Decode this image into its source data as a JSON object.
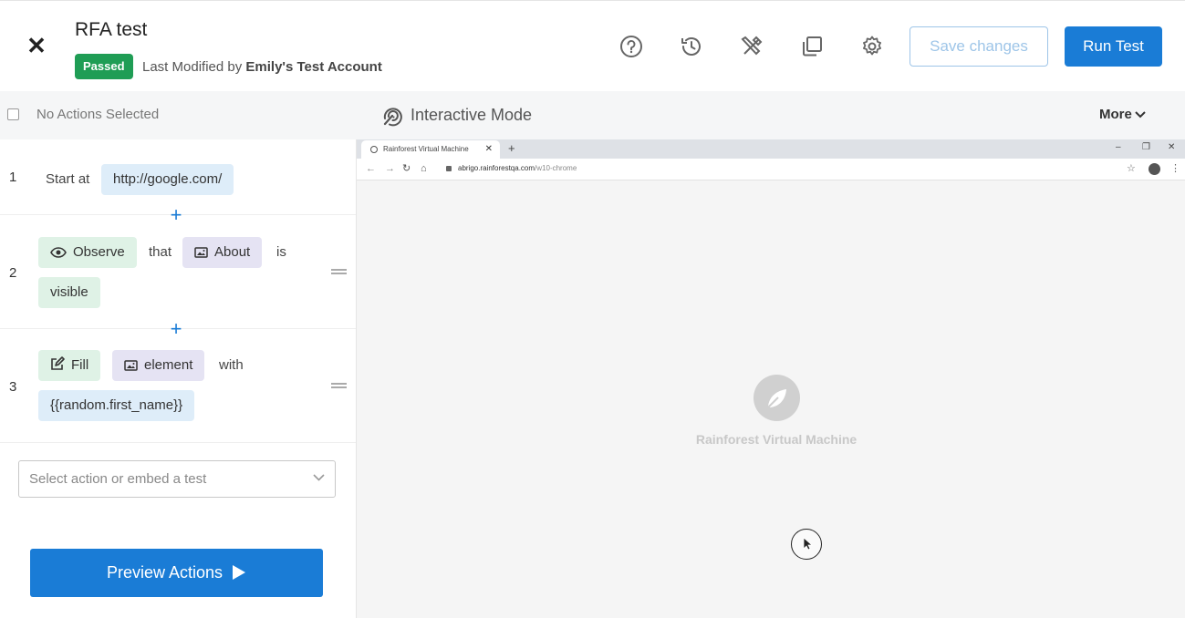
{
  "header": {
    "title": "RFA test",
    "status_badge": "Passed",
    "modified_prefix": "Last Modified by",
    "modified_by": "Emily's Test Account",
    "save_label": "Save changes",
    "run_label": "Run Test",
    "icons": [
      "close-icon",
      "help-icon",
      "history-icon",
      "tools-icon",
      "duplicate-icon",
      "settings-icon"
    ]
  },
  "subbar": {
    "selection_text": "No Actions Selected",
    "mode_label": "Interactive Mode",
    "more_label": "More"
  },
  "steps": [
    {
      "number": "1",
      "prefix": "Start at",
      "url": "http://google.com/"
    },
    {
      "number": "2",
      "action": "Observe",
      "word1": "that",
      "element": "About",
      "word2": "is",
      "value": "visible"
    },
    {
      "number": "3",
      "action": "Fill",
      "element": "element",
      "word1": "with",
      "value": "{{random.first_name}}"
    }
  ],
  "actions": {
    "select_placeholder": "Select action or embed a test",
    "preview_label": "Preview Actions"
  },
  "vm": {
    "tab_title": "Rainforest Virtual Machine",
    "url_host": "abrigo.rainforestqa.com",
    "url_path": "/w10-chrome",
    "logo_text": "Rainforest Virtual Machine"
  },
  "colors": {
    "accent": "#1a7cd6",
    "passed": "#1f9d55",
    "chip_url": "#deedf9",
    "chip_action": "#dff2e6",
    "chip_element": "#e5e3f3"
  }
}
